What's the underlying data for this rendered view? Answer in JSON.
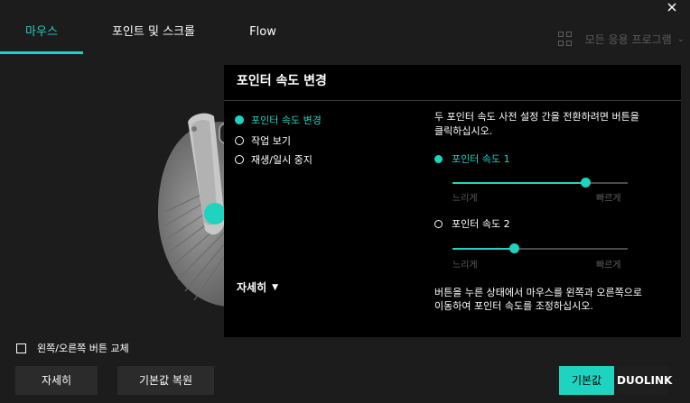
{
  "tabs": [
    {
      "label": "마우스",
      "active": true
    },
    {
      "label": "포인트 및 스크롤",
      "active": false
    },
    {
      "label": "Flow",
      "active": false
    }
  ],
  "app_selector": {
    "label": "모든 응용 프로그램",
    "icon": "grid-icon"
  },
  "popup": {
    "title": "포인터 속도 변경",
    "options": [
      {
        "label": "포인터 속도 변경",
        "selected": true
      },
      {
        "label": "작업 보기",
        "selected": false
      },
      {
        "label": "재생/일시 중지",
        "selected": false
      }
    ],
    "more_label": "자세히",
    "description": "두 포인터 속도 사전 설정 간을 전환하려면 버튼을 클릭하십시오.",
    "speed1": {
      "label": "포인터 속도 1",
      "active": true,
      "value": 0.76
    },
    "speed2": {
      "label": "포인터 속도 2",
      "active": false,
      "value": 0.35
    },
    "slow_label": "느리게",
    "fast_label": "빠르게",
    "bottom_description": "버튼을 누른 상태에서 마우스를 왼쪽과 오른쪽으로 이동하여 포인터 속도를 조정하십시오."
  },
  "swap_buttons_label": "왼쪽/오른쪽 버튼 교체",
  "buttons": {
    "detail": "자세히",
    "restore_default": "기본값 복원",
    "default": "기본값",
    "duolink": "DUOLINK"
  },
  "colors": {
    "accent": "#1ed3c0",
    "background": "#1c1c1c",
    "popup": "#000000"
  }
}
